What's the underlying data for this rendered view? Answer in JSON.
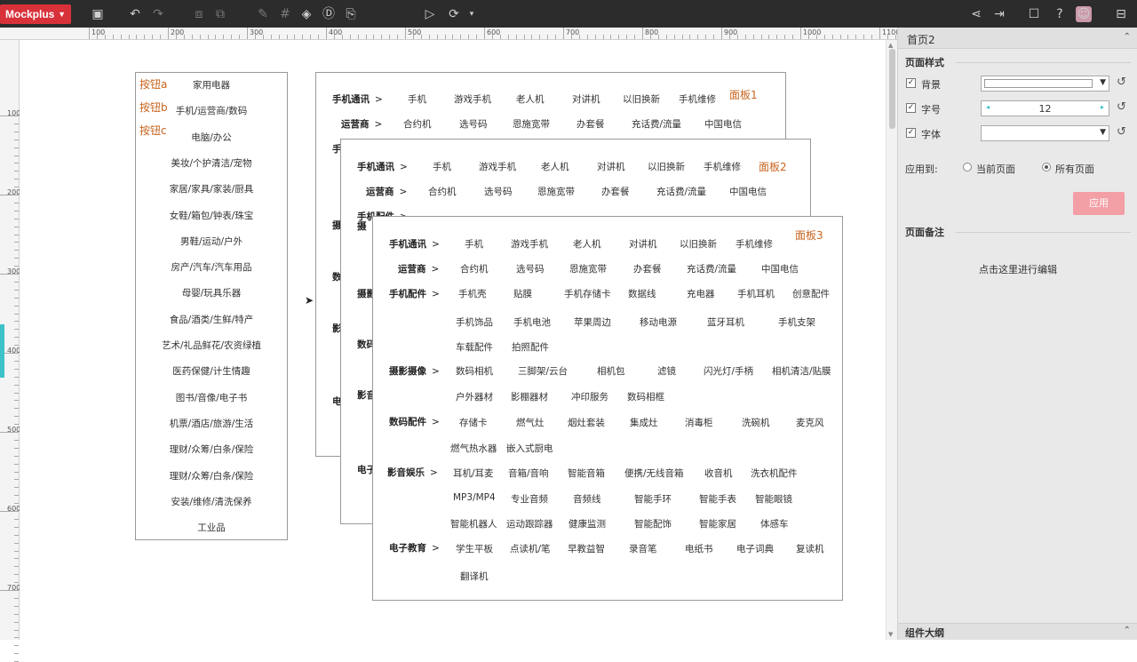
{
  "app": {
    "name": "Mockplus"
  },
  "ruler": {
    "top": [
      "100",
      "200",
      "300",
      "400",
      "500",
      "600",
      "700",
      "800",
      "900",
      "1000",
      "1100"
    ],
    "left": [
      "100",
      "200",
      "300",
      "400",
      "500",
      "600",
      "700"
    ]
  },
  "left_list": {
    "buttons": [
      "按钮a",
      "按钮b",
      "按钮c"
    ],
    "items": [
      "家用电器",
      "手机/运营商/数码",
      "电脑/办公",
      "美妆/个护清洁/宠物",
      "家居/家具/家装/厨具",
      "女鞋/箱包/钟表/珠宝",
      "男鞋/运动/户外",
      "房产/汽车/汽车用品",
      "母婴/玩具乐器",
      "食品/酒类/生鲜/特产",
      "艺术/礼品鲜花/农资绿植",
      "医药保健/计生情趣",
      "图书/音像/电子书",
      "机票/酒店/旅游/生活",
      "理财/众筹/白条/保险",
      "理财/众筹/白条/保险",
      "安装/维修/清洗保养",
      "工业品"
    ]
  },
  "panel1": {
    "title": "面板1",
    "row1_cat": "手机通讯",
    "row1": [
      "手机",
      "游戏手机",
      "老人机",
      "对讲机",
      "以旧换新",
      "手机维修"
    ],
    "row2_cat": "运营商",
    "row2": [
      "合约机",
      "选号码",
      "恩施宽带",
      "办套餐",
      "充话费/流量",
      "中国电信"
    ],
    "peek": [
      "手",
      "摄",
      "数",
      "影",
      "电"
    ]
  },
  "panel2": {
    "title": "面板2",
    "row1_cat": "手机通讯",
    "row1": [
      "手机",
      "游戏手机",
      "老人机",
      "对讲机",
      "以旧换新",
      "手机维修"
    ],
    "row2_cat": "运营商",
    "row2": [
      "合约机",
      "选号码",
      "恩施宽带",
      "办套餐",
      "充话费/流量",
      "中国电信"
    ],
    "row3_cat": "手机配件",
    "peek": [
      "摄",
      "摄影",
      "数码",
      "影音",
      "电子"
    ]
  },
  "panel3": {
    "title": "面板3",
    "categories": [
      "手机通讯",
      "运营商",
      "手机配件",
      "摄影摄像",
      "数码配件",
      "影音娱乐",
      "电子教育"
    ],
    "rows": [
      [
        "手机",
        "游戏手机",
        "老人机",
        "对讲机",
        "以旧换新",
        "手机维修"
      ],
      [
        "合约机",
        "选号码",
        "恩施宽带",
        "办套餐",
        "充话费/流量",
        "中国电信"
      ],
      [
        "手机壳",
        "贴膜",
        "手机存储卡",
        "数据线",
        "充电器",
        "手机耳机",
        "创意配件"
      ],
      [
        "手机饰品",
        "手机电池",
        "苹果周边",
        "移动电源",
        "蓝牙耳机",
        "手机支架"
      ],
      [
        "车载配件",
        "拍照配件"
      ],
      [
        "数码相机",
        "三脚架/云台",
        "相机包",
        "滤镜",
        "闪光灯/手柄",
        "相机清洁/贴膜"
      ],
      [
        "户外器材",
        "影棚器材",
        "冲印服务",
        "数码相框"
      ],
      [
        "存储卡",
        "燃气灶",
        "烟灶套装",
        "集成灶",
        "消毒柜",
        "洗碗机",
        "麦克风"
      ],
      [
        "燃气热水器",
        "嵌入式厨电"
      ],
      [
        "耳机/耳麦",
        "音箱/音响",
        "智能音箱",
        "便携/无线音箱",
        "收音机",
        "洗衣机配件"
      ],
      [
        "MP3/MP4",
        "专业音频",
        "音频线",
        "智能手环",
        "智能手表",
        "智能眼镜"
      ],
      [
        "智能机器人",
        "运动跟踪器",
        "健康监测",
        "智能配饰",
        "智能家居",
        "体感车"
      ],
      [
        "学生平板",
        "点读机/笔",
        "早教益智",
        "录音笔",
        "电纸书",
        "电子词典",
        "复读机"
      ],
      [
        "翻译机"
      ]
    ]
  },
  "right_panel": {
    "page_name": "首页2",
    "section_style": "页面样式",
    "bg_label": "背景",
    "font_size_label": "字号",
    "font_size_value": "12",
    "font_label": "字体",
    "apply_to_label": "应用到:",
    "apply_current": "当前页面",
    "apply_all": "所有页面",
    "apply_button": "应用",
    "section_notes": "页面备注",
    "notes_placeholder": "点击这里进行编辑",
    "footer": "组件大纲"
  }
}
